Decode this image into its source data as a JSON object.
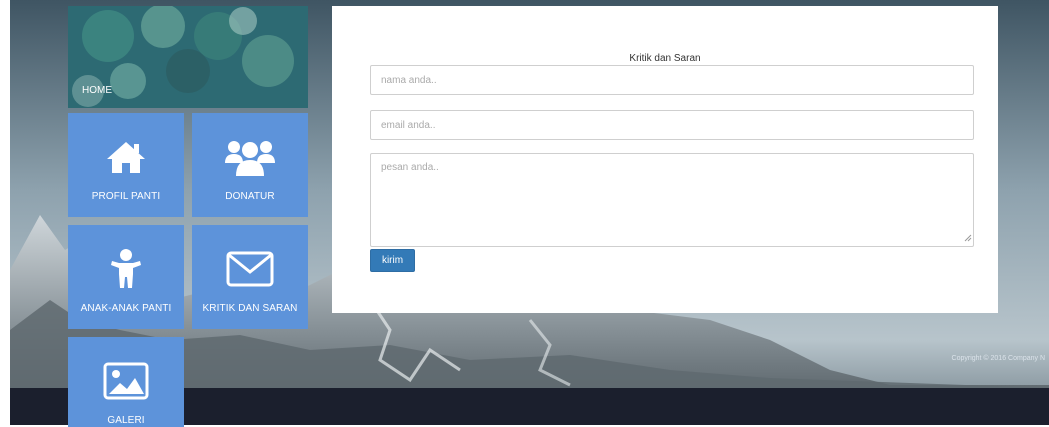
{
  "menu": {
    "home_label": "HOME",
    "tiles": [
      {
        "label": "PROFIL PANTI",
        "icon": "home-icon"
      },
      {
        "label": "DONATUR",
        "icon": "users-icon"
      },
      {
        "label": "ANAK-ANAK PANTI",
        "icon": "child-icon"
      },
      {
        "label": "KRITIK DAN SARAN",
        "icon": "envelope-icon"
      },
      {
        "label": "GALERI",
        "icon": "image-icon"
      }
    ]
  },
  "form": {
    "title": "Kritik dan Saran",
    "name_placeholder": "nama anda..",
    "email_placeholder": "email anda..",
    "message_placeholder": "pesan anda..",
    "submit_label": "kirim"
  },
  "footer": {
    "copyright": "Copyright © 2016 Company N"
  },
  "colors": {
    "tile": "#5d93da",
    "submit": "#337ab7",
    "footer": "#1b1f2d"
  }
}
